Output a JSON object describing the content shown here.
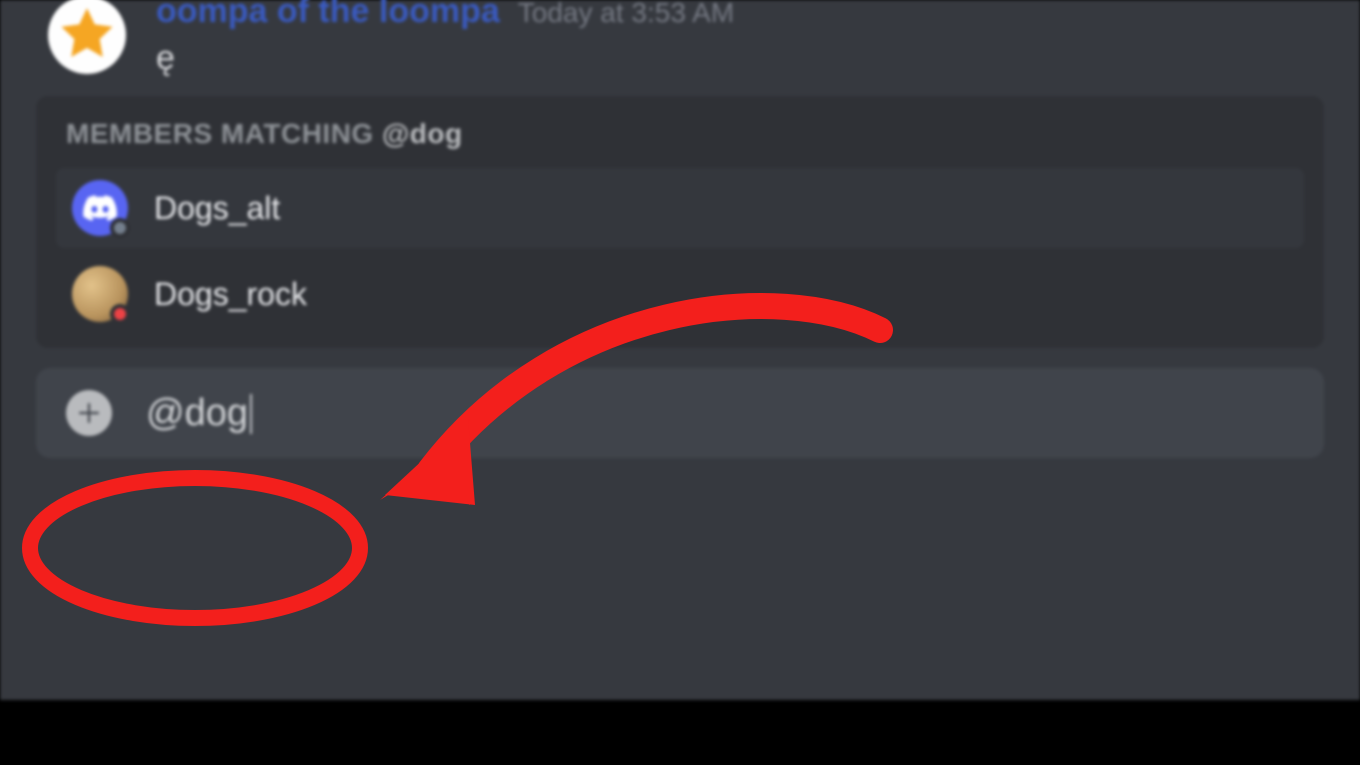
{
  "message": {
    "author": "oompa of the loompa",
    "timestamp": "Today at 3:53 AM",
    "content": "ę"
  },
  "autocomplete": {
    "header_prefix": "MEMBERS MATCHING",
    "query": "@dog",
    "members": [
      {
        "name": "Dogs_alt",
        "avatar": "discord",
        "status": "offline"
      },
      {
        "name": "Dogs_rock",
        "avatar": "dog",
        "status": "dnd"
      }
    ]
  },
  "composer": {
    "input_value": "@dog"
  },
  "colors": {
    "bg_chat": "#36393f",
    "bg_panel": "#2f3136",
    "bg_composer": "#40444b",
    "accent_blurple": "#5865f2",
    "annotation_red": "#f31f1c"
  }
}
